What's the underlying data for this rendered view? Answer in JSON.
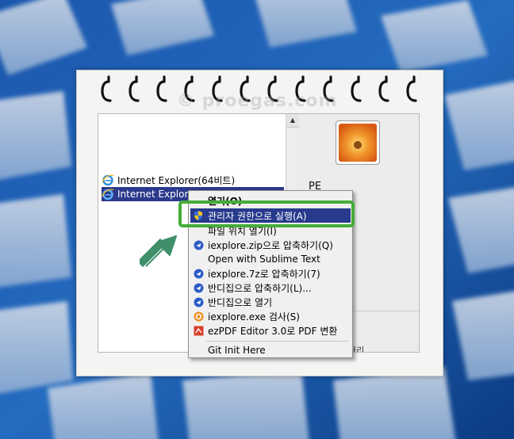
{
  "watermark": "© proegas.com",
  "file_list": {
    "items": [
      {
        "label": "Internet Explorer(64비트)",
        "icon": "ie-icon",
        "selected": false
      },
      {
        "label": "Internet Explorer",
        "icon": "ie-icon",
        "selected": true
      }
    ]
  },
  "right_pane": {
    "label": "PE",
    "tail_text": "관리"
  },
  "context_menu": {
    "items": [
      {
        "label": "열기(O)",
        "icon": "",
        "style": "bold"
      },
      {
        "label": "관리자 권한으로 실행(A)",
        "icon": "uac-shield-icon",
        "highlighted": true
      },
      {
        "label": "파일 위치 열기(I)",
        "icon": ""
      },
      {
        "label": "iexplore.zip으로 압축하기(Q)",
        "icon": "bandizip-icon"
      },
      {
        "label": "Open with Sublime Text",
        "icon": ""
      },
      {
        "label": "iexplore.7z로 압축하기(7)",
        "icon": "bandizip-icon"
      },
      {
        "label": "반디집으로 압축하기(L)...",
        "icon": "bandizip-icon"
      },
      {
        "label": "반디집으로 열기",
        "icon": "bandizip-icon"
      },
      {
        "label": "iexplore.exe 검사(S)",
        "icon": "antivirus-icon"
      },
      {
        "label": "ezPDF Editor 3.0로 PDF 변환",
        "icon": "ezpdf-icon"
      },
      {
        "label": "Git Init Here",
        "icon": ""
      }
    ]
  },
  "colors": {
    "selection": "#2b3a8c",
    "highlight_box": "#44ac38",
    "arrow": "#3f8f6a"
  }
}
